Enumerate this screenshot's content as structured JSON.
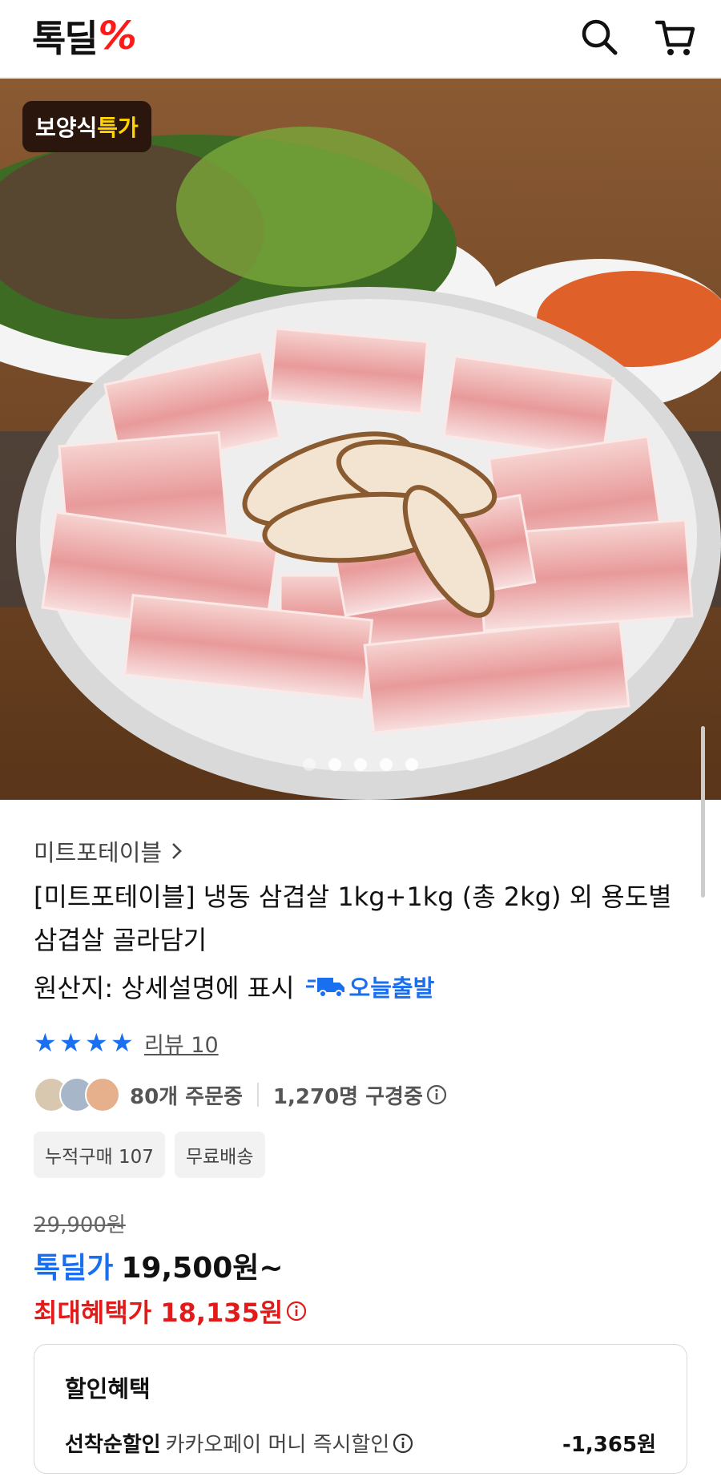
{
  "header": {
    "logo_text": "톡딜",
    "logo_mark": "%"
  },
  "hero": {
    "badge_prefix": "보양식",
    "badge_highlight": "특가",
    "slide_count": 5,
    "active_slide": 1
  },
  "product": {
    "seller": "미트포테이블",
    "title": "[미트포테이블] 냉동 삼겹살 1kg+1kg (총 2kg) 외 용도별 삼겹살 골라담기",
    "origin": "원산지: 상세설명에 표시",
    "shipping_badge": "오늘출발",
    "rating_stars": 4,
    "review_label": "리뷰 10",
    "orders": "80개 주문중",
    "viewers": "1,270명 구경중",
    "chips": [
      "누적구매 107",
      "무료배송"
    ],
    "original_price": "29,900원",
    "deal_label": "톡딜가",
    "deal_price": "19,500원~",
    "max_benefit": "최대혜택가 18,135원"
  },
  "benefit": {
    "title": "할인혜택",
    "row_label": "선착순할인",
    "row_desc": "카카오페이 머니 즉시할인",
    "row_amount": "-1,365원"
  },
  "colors": {
    "accent_blue": "#1a6ef0",
    "accent_red": "#e11a1a",
    "logo_red": "#ff1a1a"
  }
}
